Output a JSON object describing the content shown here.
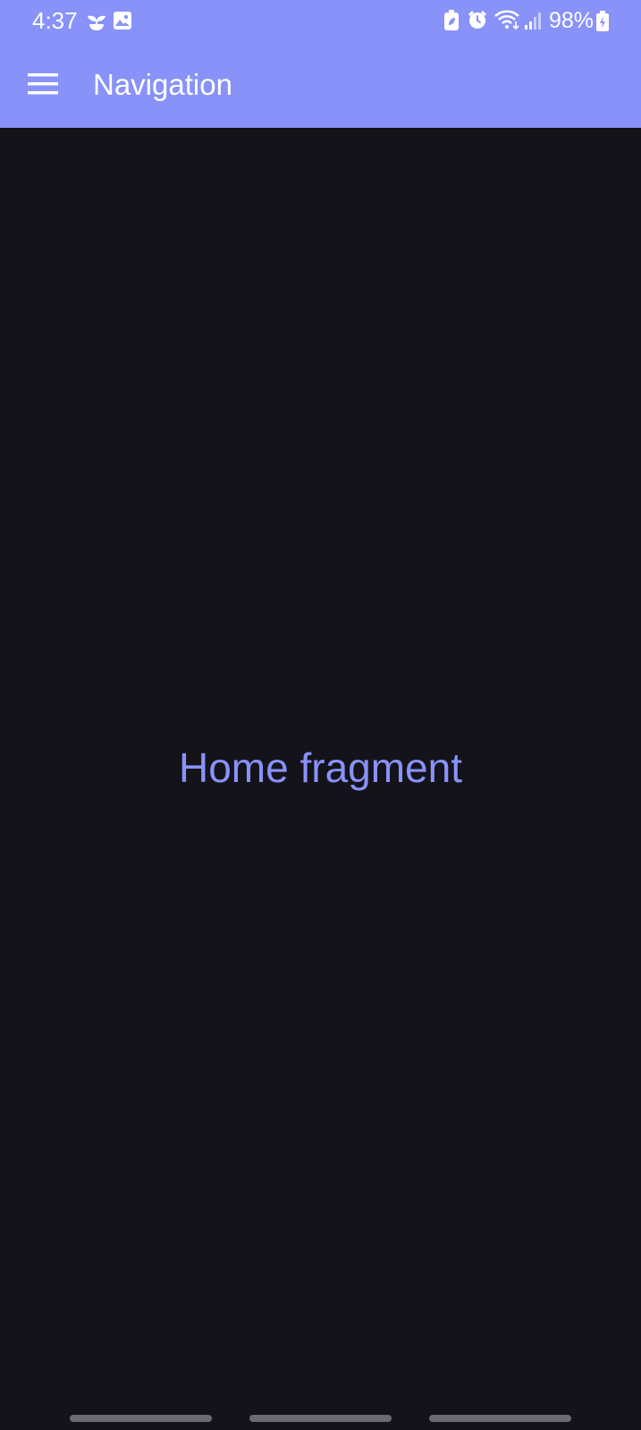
{
  "status_bar": {
    "time": "4:37",
    "battery_percent": "98%",
    "left_icons": [
      "sprout-icon",
      "image-icon"
    ],
    "right_icons": [
      "battery-saver-icon",
      "alarm-icon",
      "wifi-icon",
      "signal-icon",
      "battery-charging-icon"
    ]
  },
  "toolbar": {
    "title": "Navigation",
    "menu_icon": "hamburger-menu-icon",
    "background_color": "#8892f9"
  },
  "content": {
    "text": "Home fragment",
    "text_color": "#8892f9",
    "background_color": "#15131a"
  },
  "nav_bar": {
    "buttons": [
      "recents",
      "home",
      "back"
    ]
  }
}
